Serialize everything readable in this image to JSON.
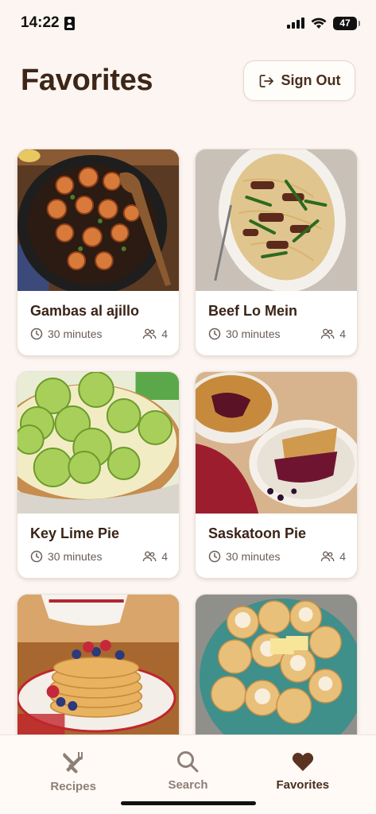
{
  "status": {
    "time": "14:22",
    "battery": "47"
  },
  "header": {
    "title": "Favorites",
    "sign_out_label": "Sign Out"
  },
  "recipes": [
    {
      "title": "Gambas al ajillo",
      "time": "30 minutes",
      "servings": "4"
    },
    {
      "title": "Beef Lo Mein",
      "time": "30 minutes",
      "servings": "4"
    },
    {
      "title": "Key Lime Pie",
      "time": "30 minutes",
      "servings": "4"
    },
    {
      "title": "Saskatoon Pie",
      "time": "30 minutes",
      "servings": "4"
    },
    {
      "title": "",
      "time": "",
      "servings": ""
    },
    {
      "title": "",
      "time": "",
      "servings": ""
    }
  ],
  "nav": {
    "recipes": "Recipes",
    "search": "Search",
    "favorites": "Favorites"
  },
  "icons": {
    "sign_out": "sign-out-icon",
    "clock": "clock-icon",
    "servings": "people-icon",
    "recipes": "fork-knife-icon",
    "search": "search-icon",
    "favorites": "heart-icon"
  },
  "colors": {
    "accent": "#4a2e1d",
    "background": "#fcf5f1",
    "inactive": "#8e7f76"
  }
}
